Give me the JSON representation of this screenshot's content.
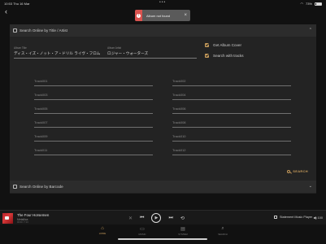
{
  "status": {
    "time": "10:53",
    "date": "Thu 16 Mar",
    "dots": "•••",
    "battery": "73%"
  },
  "toast": {
    "message": "Album not found"
  },
  "search_panel": {
    "title": "Search Online by Title / Artist",
    "album_title_label": "Album Title",
    "album_title_value": "ディス・イズ・ノット・ア・ドリル ライヴ・フロム",
    "album_artist_label": "Album Artist",
    "album_artist_value": "ロジャー・ウォーターズ",
    "get_album_cover": "Get Album Cover",
    "search_with_tracks": "Search with tracks",
    "tracks": [
      "Track001",
      "Track002",
      "Track003",
      "Track004",
      "Track005",
      "Track006",
      "Track007",
      "Track008",
      "Track009",
      "Track010",
      "Track011",
      "Track012"
    ],
    "search_button": "SEARCH"
  },
  "barcode_panel": {
    "title": "Search Online by Barcode"
  },
  "player": {
    "track_title": "The Four Horsemen",
    "subtitle": "Metallica",
    "time": "00:00 / 7:13",
    "output": "Statement Music Player",
    "volume": "100"
  },
  "tabs": [
    {
      "label": "HOME",
      "icon": "home-icon"
    },
    {
      "label": "MUSIC",
      "icon": "music-icon"
    },
    {
      "label": "SYSTEM",
      "icon": "system-icon"
    },
    {
      "label": "SEARCH",
      "icon": "search-icon"
    }
  ],
  "colors": {
    "accent": "#c59a5a",
    "error": "#d9534f",
    "panel": "#232323",
    "background": "#111111"
  }
}
